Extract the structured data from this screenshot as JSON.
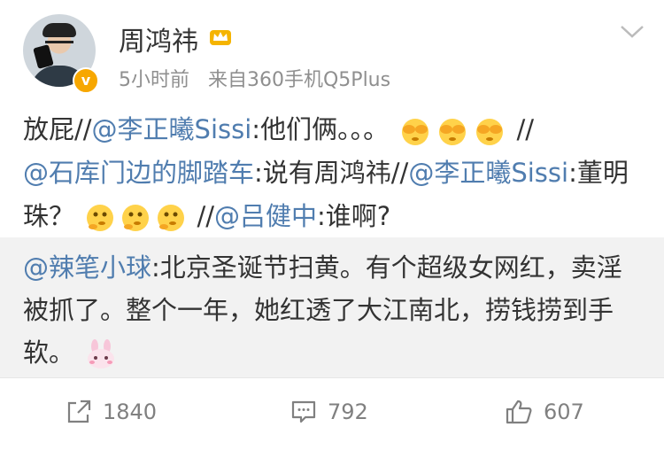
{
  "post": {
    "username": "周鸿祎",
    "time": "5小时前",
    "source": "来自360手机Q5Plus",
    "verified_badge": "v",
    "content": {
      "t1": "放屁//",
      "at1": "@李正曦Sissi",
      "t2": ":他们俩。。。",
      "t3": " //",
      "at2": "@石库门边的脚踏车",
      "t4": ":说有周鸿祎//",
      "at3": "@李正曦Sissi",
      "t5": ":董明珠？",
      "t6": " //",
      "at4": "@吕健中",
      "t7": ":谁啊?"
    }
  },
  "repost": {
    "at": "@辣笔小球",
    "text": ":北京圣诞节扫黄。有个超级女网红，卖淫被抓了。整个一年，她红透了大江南北，捞钱捞到手软。"
  },
  "actions": {
    "repost_count": "1840",
    "comment_count": "792",
    "like_count": "607"
  },
  "colors": {
    "link": "#507daf",
    "meta": "#8f8f8f",
    "repost_bg": "#f2f2f2",
    "badge": "#f7a700"
  },
  "icons": [
    "crown-icon",
    "chevron-down-icon",
    "see-no-evil-emoji",
    "thinking-face-emoji",
    "rabbit-emoji",
    "repost-icon",
    "comment-icon",
    "like-icon"
  ]
}
